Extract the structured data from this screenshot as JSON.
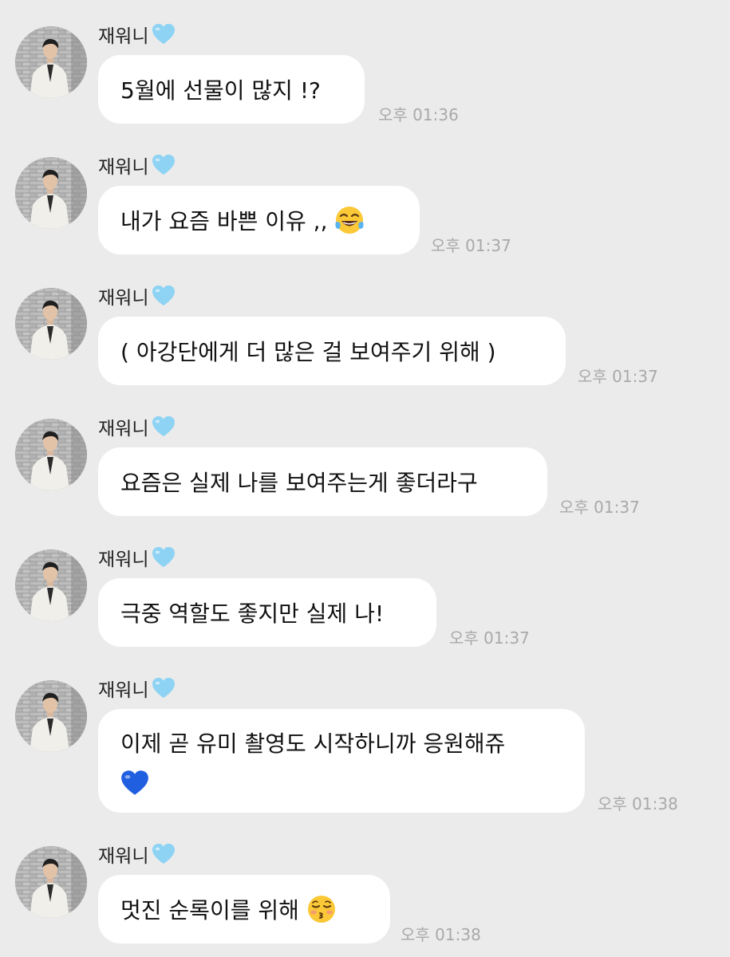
{
  "chat": {
    "sender_name": "재워니",
    "heart_color": "#8ed3f4",
    "bubble_color": "#ffffff",
    "background_color": "#ebebeb",
    "messages": [
      {
        "text": "5월에 선물이 많지 !?",
        "time": "오후 01:36"
      },
      {
        "text": "내가 요즘 바쁜 이유 ,,",
        "emoji": "tears-of-joy-emoji",
        "time": "오후 01:37"
      },
      {
        "text": "( 아강단에게 더 많은 걸 보여주기 위해 )",
        "time": "오후 01:37"
      },
      {
        "text": "요즘은 실제 나를 보여주는게 좋더라구",
        "time": "오후 01:37"
      },
      {
        "text": "극중 역할도 좋지만 실제 나!",
        "time": "오후 01:37"
      },
      {
        "text": "이제 곧 유미 촬영도 시작하니까 응원해쥬",
        "emoji": "blue-heart-emoji",
        "time": "오후 01:38"
      },
      {
        "text": "멋진 순록이를 위해",
        "emoji": "kissing-face-emoji",
        "time": "오후 01:38"
      }
    ]
  }
}
